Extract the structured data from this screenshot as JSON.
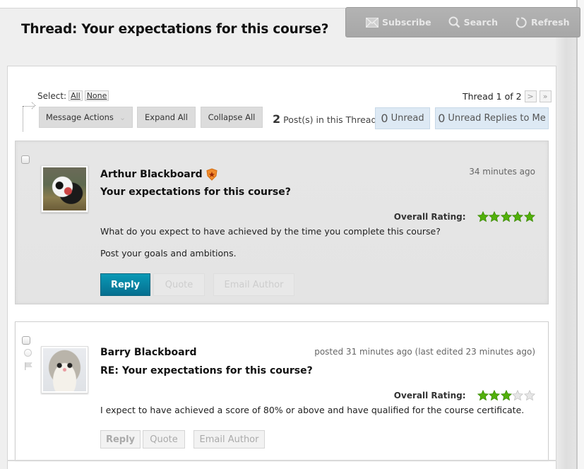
{
  "page": {
    "title": "Thread: Your expectations for this course?"
  },
  "toolbar": {
    "subscribe_label": "Subscribe",
    "search_label": "Search",
    "refresh_label": "Refresh"
  },
  "controls": {
    "select_label": "Select:",
    "select_all": "All",
    "select_none": "None",
    "message_actions_label": "Message Actions",
    "expand_all_label": "Expand All",
    "collapse_all_label": "Collapse All",
    "posts_count": "2",
    "posts_count_suffix": "Post(s) in this Thread",
    "unread_count": "0",
    "unread_label": "Unread",
    "unread_replies_count": "0",
    "unread_replies_label": "Unread Replies to Me",
    "thread_position": "Thread 1 of 2",
    "next_glyph": ">",
    "last_glyph": "»"
  },
  "posts": [
    {
      "author": "Arthur Blackboard",
      "badge_icon": "star-badge-icon",
      "subject": "Your expectations for this course?",
      "timestamp": "34 minutes ago",
      "rating_label": "Overall Rating:",
      "rating": 5,
      "rating_max": 5,
      "body": [
        "What do you expect to have achieved by the time you complete this course?",
        "Post your goals and ambitions."
      ],
      "reply_label": "Reply",
      "quote_label": "Quote",
      "email_label": "Email Author",
      "avatar_icon": "panda-avatar"
    },
    {
      "author": "Barry Blackboard",
      "subject": "RE: Your expectations for this course?",
      "timestamp": "posted 31 minutes ago (last edited 23 minutes ago)",
      "rating_label": "Overall Rating:",
      "rating": 3,
      "rating_max": 5,
      "body": [
        "I expect to have achieved a score of 80% or above and have qualified for the course certificate."
      ],
      "reply_label": "Reply",
      "quote_label": "Quote",
      "email_label": "Email Author",
      "avatar_icon": "cat-avatar"
    }
  ],
  "colors": {
    "star_on": "#52b00a",
    "star_off": "#e6e6e6",
    "primary_button": "#0a86a4",
    "unread_bg": "#dde9f4"
  }
}
